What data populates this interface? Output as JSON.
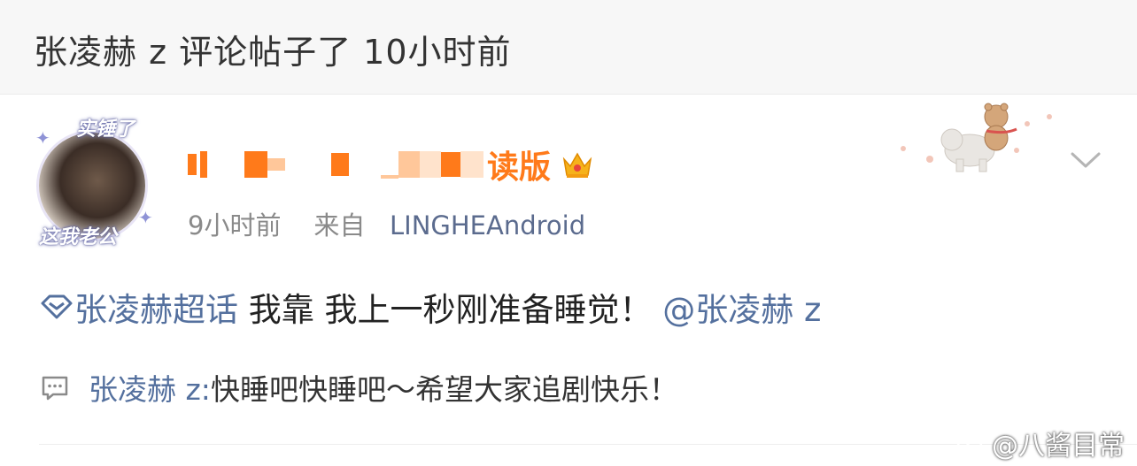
{
  "header": {
    "text": "张凌赫 z 评论帖子了 10小时前"
  },
  "avatar": {
    "tag_top": "实锤了",
    "tag_bottom": "这我老公"
  },
  "post": {
    "username_visible_suffix": "读版",
    "time": "9小时前",
    "source_prefix": "来自",
    "source": "LINGHEAndroid",
    "topic": "张凌赫超话",
    "body": "我靠 我上一秒刚准备睡觉！",
    "mention": "@张凌赫 z"
  },
  "comment": {
    "author": "张凌赫 z:",
    "text": " 快睡吧快睡吧～希望大家追剧快乐！"
  },
  "watermark": {
    "text": "@八酱目常"
  },
  "icons": {
    "topic": "super-topic-diamond-icon",
    "crown": "crown-badge-icon",
    "chevron": "chevron-down-icon",
    "comment": "comment-bubble-icon",
    "weibo": "weibo-logo-icon"
  },
  "colors": {
    "link": "#54709e",
    "username": "#ff7a1a",
    "meta": "#8a8a8a"
  }
}
